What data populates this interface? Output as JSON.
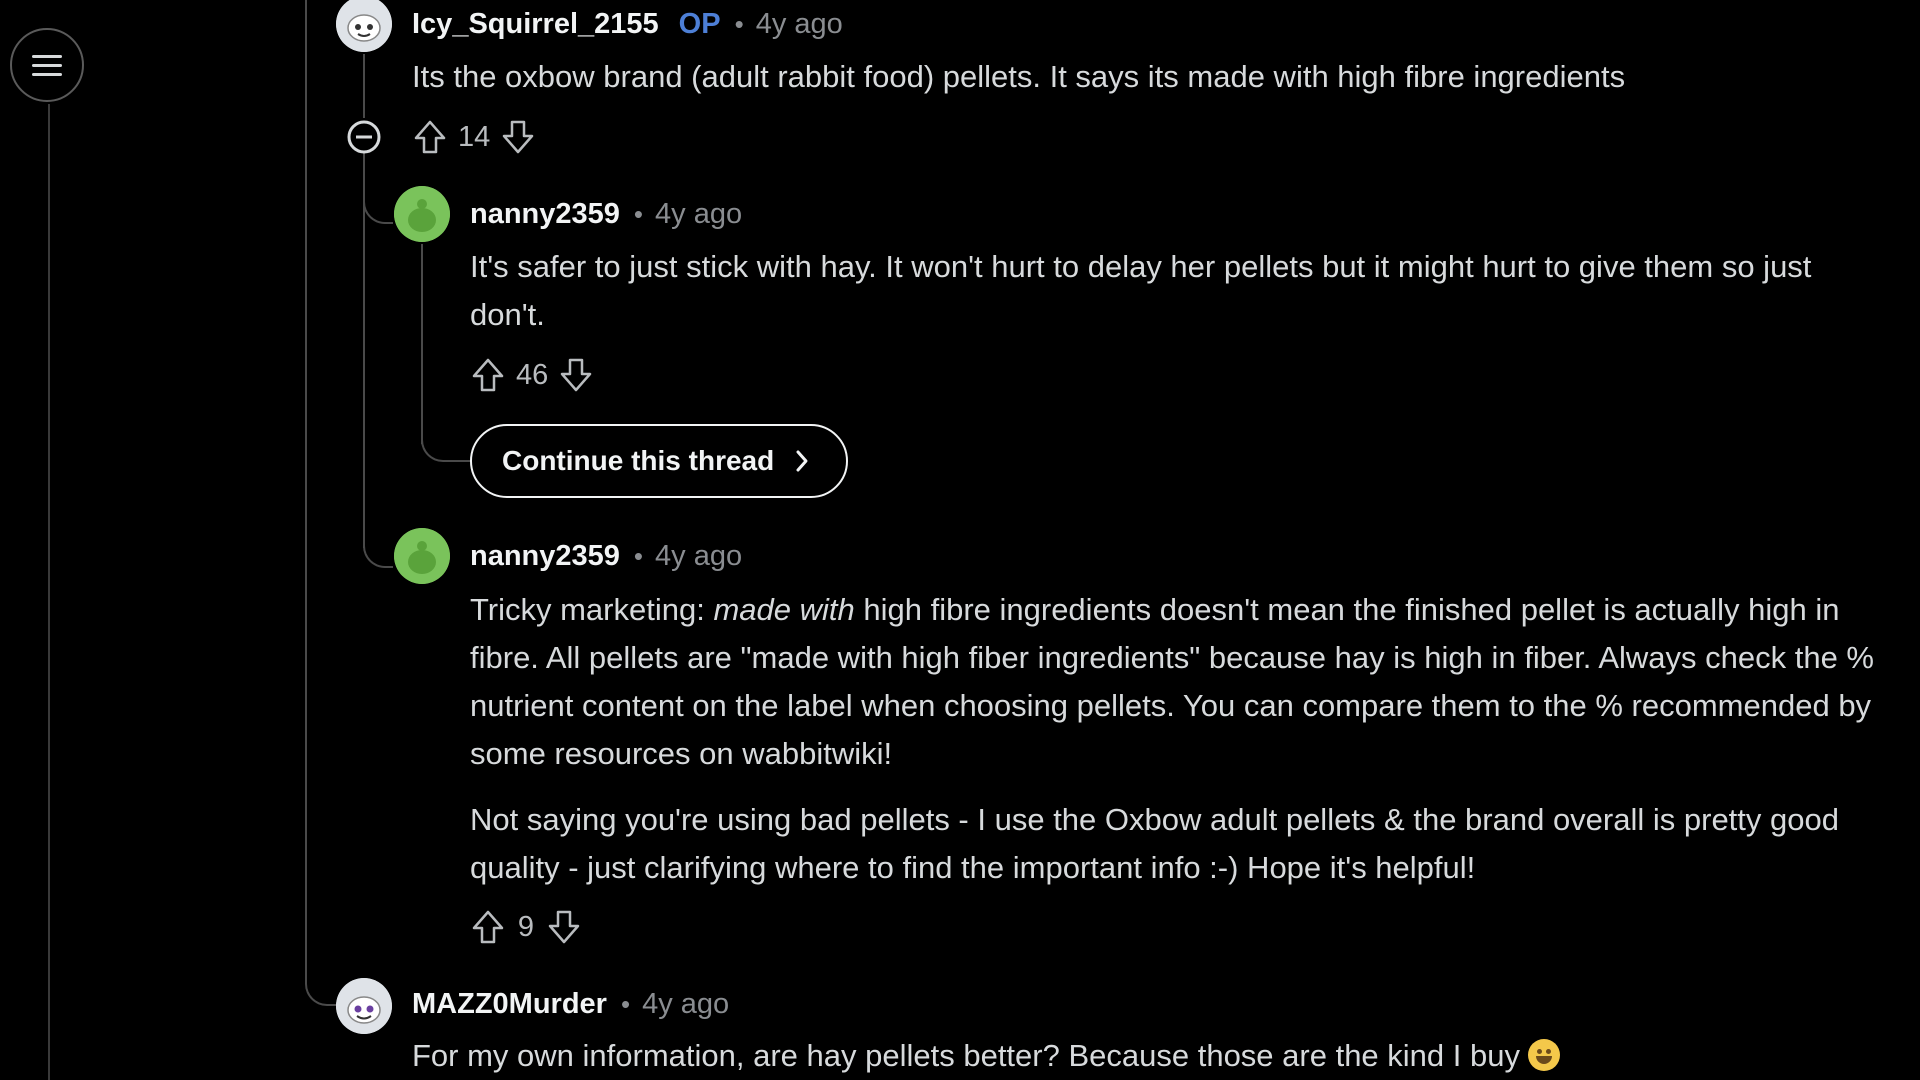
{
  "sidebar": {
    "menu_icon": "hamburger-menu-icon"
  },
  "comments": [
    {
      "username": "Icy_Squirrel_2155",
      "badge": "OP",
      "separator": "•",
      "time": "4y ago",
      "avatar_icon": "snoo-avatar-icon",
      "body": [
        "Its the oxbow brand (adult rabbit food) pellets. It says its made with high fibre ingredients"
      ],
      "votes": "14",
      "collapse_icon": "collapse-minus-icon"
    },
    {
      "username": "nanny2359",
      "separator": "•",
      "time": "4y ago",
      "avatar_icon": "green-snoo-avatar-icon",
      "body": [
        "It's safer to just stick with hay. It won't hurt to delay her pellets but it might hurt to give them so just don't."
      ],
      "votes": "46"
    },
    {
      "username": "nanny2359",
      "separator": "•",
      "time": "4y ago",
      "avatar_icon": "green-snoo-avatar-icon",
      "body_p1_before": "Tricky marketing: ",
      "body_p1_em": "made with",
      "body_p1_after": " high fibre ingredients doesn't mean the finished pellet is actually high in fibre. All pellets are \"made with high fiber ingredients\" because hay is high in fiber. Always check the % nutrient content on the label when choosing pellets. You can compare them to the % recommended by some resources on wabbitwiki!",
      "body_p2": "Not saying you're using bad pellets - I use the Oxbow adult pellets & the brand overall is pretty good quality - just clarifying where to find the important info :-) Hope it's helpful!",
      "votes": "9"
    },
    {
      "username": "MAZZ0Murder",
      "separator": "•",
      "time": "4y ago",
      "avatar_icon": "snoo-avatar-icon",
      "body": [
        "For my own information, are hay pellets better? Because those are the kind I buy"
      ],
      "emoji": "grinning-face-emoji"
    }
  ],
  "continue_thread": {
    "label": "Continue this thread",
    "icon": "chevron-right-icon"
  },
  "colors": {
    "background": "#000000",
    "text": "#d7dadc",
    "username": "#f2f4f5",
    "op_badge": "#4d7fd6",
    "meta": "#8a8d91",
    "avatar_green": "#7ac35b"
  }
}
